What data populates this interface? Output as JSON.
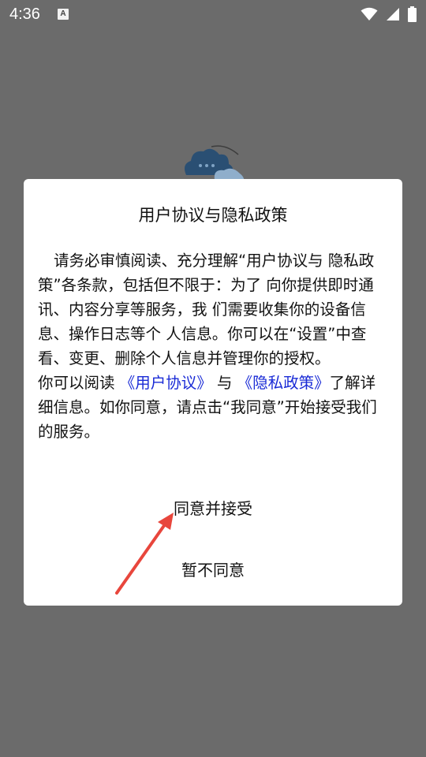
{
  "status_bar": {
    "time": "4:36",
    "notification_icon": "A"
  },
  "dialog": {
    "title": "用户协议与隐私政策",
    "body_1": "请务必审慎阅读、充分理解“用户协议与 隐私政策”各条款，包括但不限于：为了 向你提供即时通讯、内容分享等服务，我 们需要收集你的设备信息、操作日志等个 人信息。你可以在“设置”中查看、变更、删除个人信息并管理你的授权。",
    "body_2_prefix": "你可以阅读 ",
    "user_agreement_link": "《用户协议》",
    "body_2_and": " 与 ",
    "privacy_policy_link": "《隐私政策》",
    "body_2_suffix": "了解详细信息。如你同意，请点击“我同意”开始接受我们的服务。",
    "accept_label": "同意并接受",
    "decline_label": "暂不同意"
  },
  "colors": {
    "overlay": "#6b6b6b",
    "link": "#1a2bd6",
    "arrow": "#e8463c"
  }
}
